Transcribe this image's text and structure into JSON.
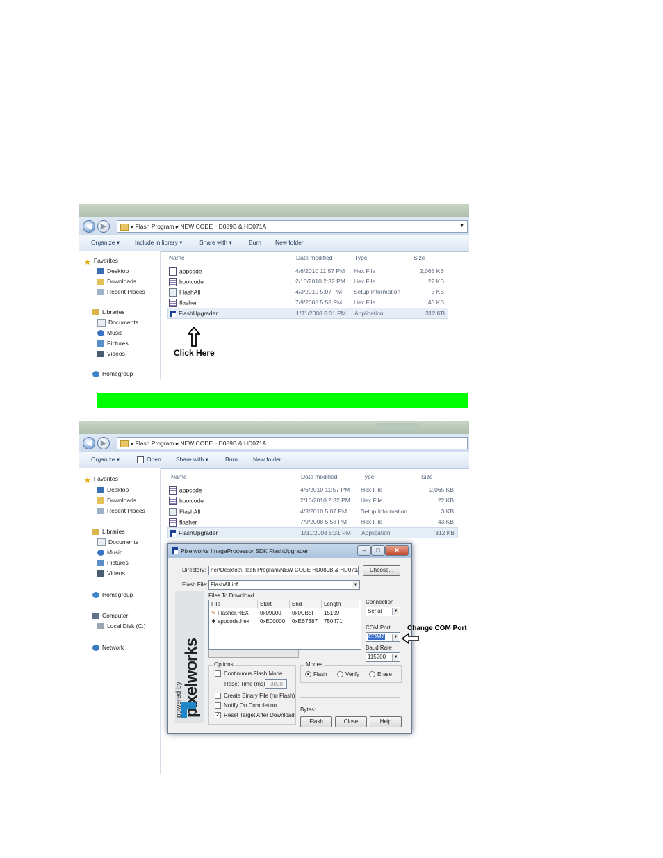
{
  "explorer1": {
    "breadcrumb": [
      "Flash Program",
      "NEW CODE HD089B & HD071A"
    ],
    "toolbar": {
      "organize": "Organize",
      "include": "Include in library",
      "share": "Share with",
      "burn": "Burn",
      "new_folder": "New folder"
    },
    "nav": {
      "favorites": "Favorites",
      "desktop": "Desktop",
      "downloads": "Downloads",
      "recent": "Recent Places",
      "libraries": "Libraries",
      "documents": "Documents",
      "music": "Music",
      "pictures": "Pictures",
      "videos": "Videos",
      "homegroup": "Homegroup"
    },
    "columns": {
      "name": "Name",
      "date": "Date modified",
      "type": "Type",
      "size": "Size"
    },
    "files": [
      {
        "name": "appcode",
        "date": "4/6/2010 11:57 PM",
        "type": "Hex File",
        "size": "2,065 KB",
        "icon": "hex-file-icon"
      },
      {
        "name": "bootcode",
        "date": "2/10/2010 2:32 PM",
        "type": "Hex File",
        "size": "22 KB",
        "icon": "hex-file-icon"
      },
      {
        "name": "FlashAll",
        "date": "4/3/2010 5:07 PM",
        "type": "Setup Information",
        "size": "3 KB",
        "icon": "setup-file-icon"
      },
      {
        "name": "flasher",
        "date": "7/9/2008 5:58 PM",
        "type": "Hex File",
        "size": "43 KB",
        "icon": "hex-file-icon"
      },
      {
        "name": "FlashUpgrader",
        "date": "1/31/2008 5:31 PM",
        "type": "Application",
        "size": "312 KB",
        "icon": "app-icon"
      }
    ],
    "annotation": "Click Here"
  },
  "highlight_color": "#00ff00",
  "explorer2": {
    "breadcrumb": [
      "Flash Program",
      "NEW CODE HD089B & HD071A"
    ],
    "toolbar": {
      "organize": "Organize",
      "open": "Open",
      "share": "Share with",
      "burn": "Burn",
      "new_folder": "New folder"
    },
    "nav": {
      "favorites": "Favorites",
      "desktop": "Desktop",
      "downloads": "Downloads",
      "recent": "Recent Places",
      "libraries": "Libraries",
      "documents": "Documents",
      "music": "Music",
      "pictures": "Pictures",
      "videos": "Videos",
      "homegroup": "Homegroup",
      "computer": "Computer",
      "local_disk": "Local Disk (C:)",
      "network": "Network"
    },
    "columns": {
      "name": "Name",
      "date": "Date modified",
      "type": "Type",
      "size": "Size"
    },
    "files": [
      {
        "name": "appcode",
        "date": "4/6/2010 11:57 PM",
        "type": "Hex File",
        "size": "2,065 KB",
        "icon": "hex-file-icon"
      },
      {
        "name": "bootcode",
        "date": "2/10/2010 2:32 PM",
        "type": "Hex File",
        "size": "22 KB",
        "icon": "hex-file-icon"
      },
      {
        "name": "FlashAll",
        "date": "4/3/2010 5:07 PM",
        "type": "Setup Information",
        "size": "3 KB",
        "icon": "setup-file-icon"
      },
      {
        "name": "flasher",
        "date": "7/9/2008 5:58 PM",
        "type": "Hex File",
        "size": "43 KB",
        "icon": "hex-file-icon"
      },
      {
        "name": "FlashUpgrader",
        "date": "1/31/2008 5:31 PM",
        "type": "Application",
        "size": "312 KB",
        "icon": "app-icon"
      }
    ]
  },
  "dialog": {
    "title": "Pixelworks ImageProcessor SDK FlashUpgrader",
    "directory_label": "Directory:",
    "directory_value": "ner\\Desktop\\Flash Program\\NEW CODE HD089B & HD071A\\",
    "choose": "Choose...",
    "flash_file_label": "Flash File:",
    "flash_file_value": "FlashAll.inf",
    "files_to_download": "Files To Download",
    "list_headers": [
      "File",
      "Start",
      "End",
      "Length"
    ],
    "list_rows": [
      {
        "file": "Flasher.HEX",
        "start": "0x09000",
        "end": "0x0CB5F",
        "length": "15199"
      },
      {
        "file": "appcode.hex",
        "start": "0xE00000",
        "end": "0xEB7387",
        "length": "750471"
      }
    ],
    "connection_label": "Connection",
    "connection_value": "Serial",
    "com_port_label": "COM Port",
    "com_port_value": "COM7",
    "baud_rate_label": "Baud Rate",
    "baud_rate_value": "115200",
    "options_label": "Options",
    "continuous": "Continuous Flash Mode",
    "reset_time_label": "Reset Time (ms)",
    "reset_time_value": "3000",
    "create_binary": "Create Binary File (no Flash)",
    "notify": "Notify On Completion",
    "reset_target": "Reset Target After Download",
    "modes_label": "Modes",
    "mode_flash": "Flash",
    "mode_verify": "Verify",
    "mode_erase": "Erase",
    "bytes_label": "Bytes:",
    "btn_flash": "Flash",
    "btn_close": "Close",
    "btn_help": "Help",
    "brand_powered": "powered by",
    "brand_name": "pixelworks"
  },
  "callout": "Change COM Port"
}
